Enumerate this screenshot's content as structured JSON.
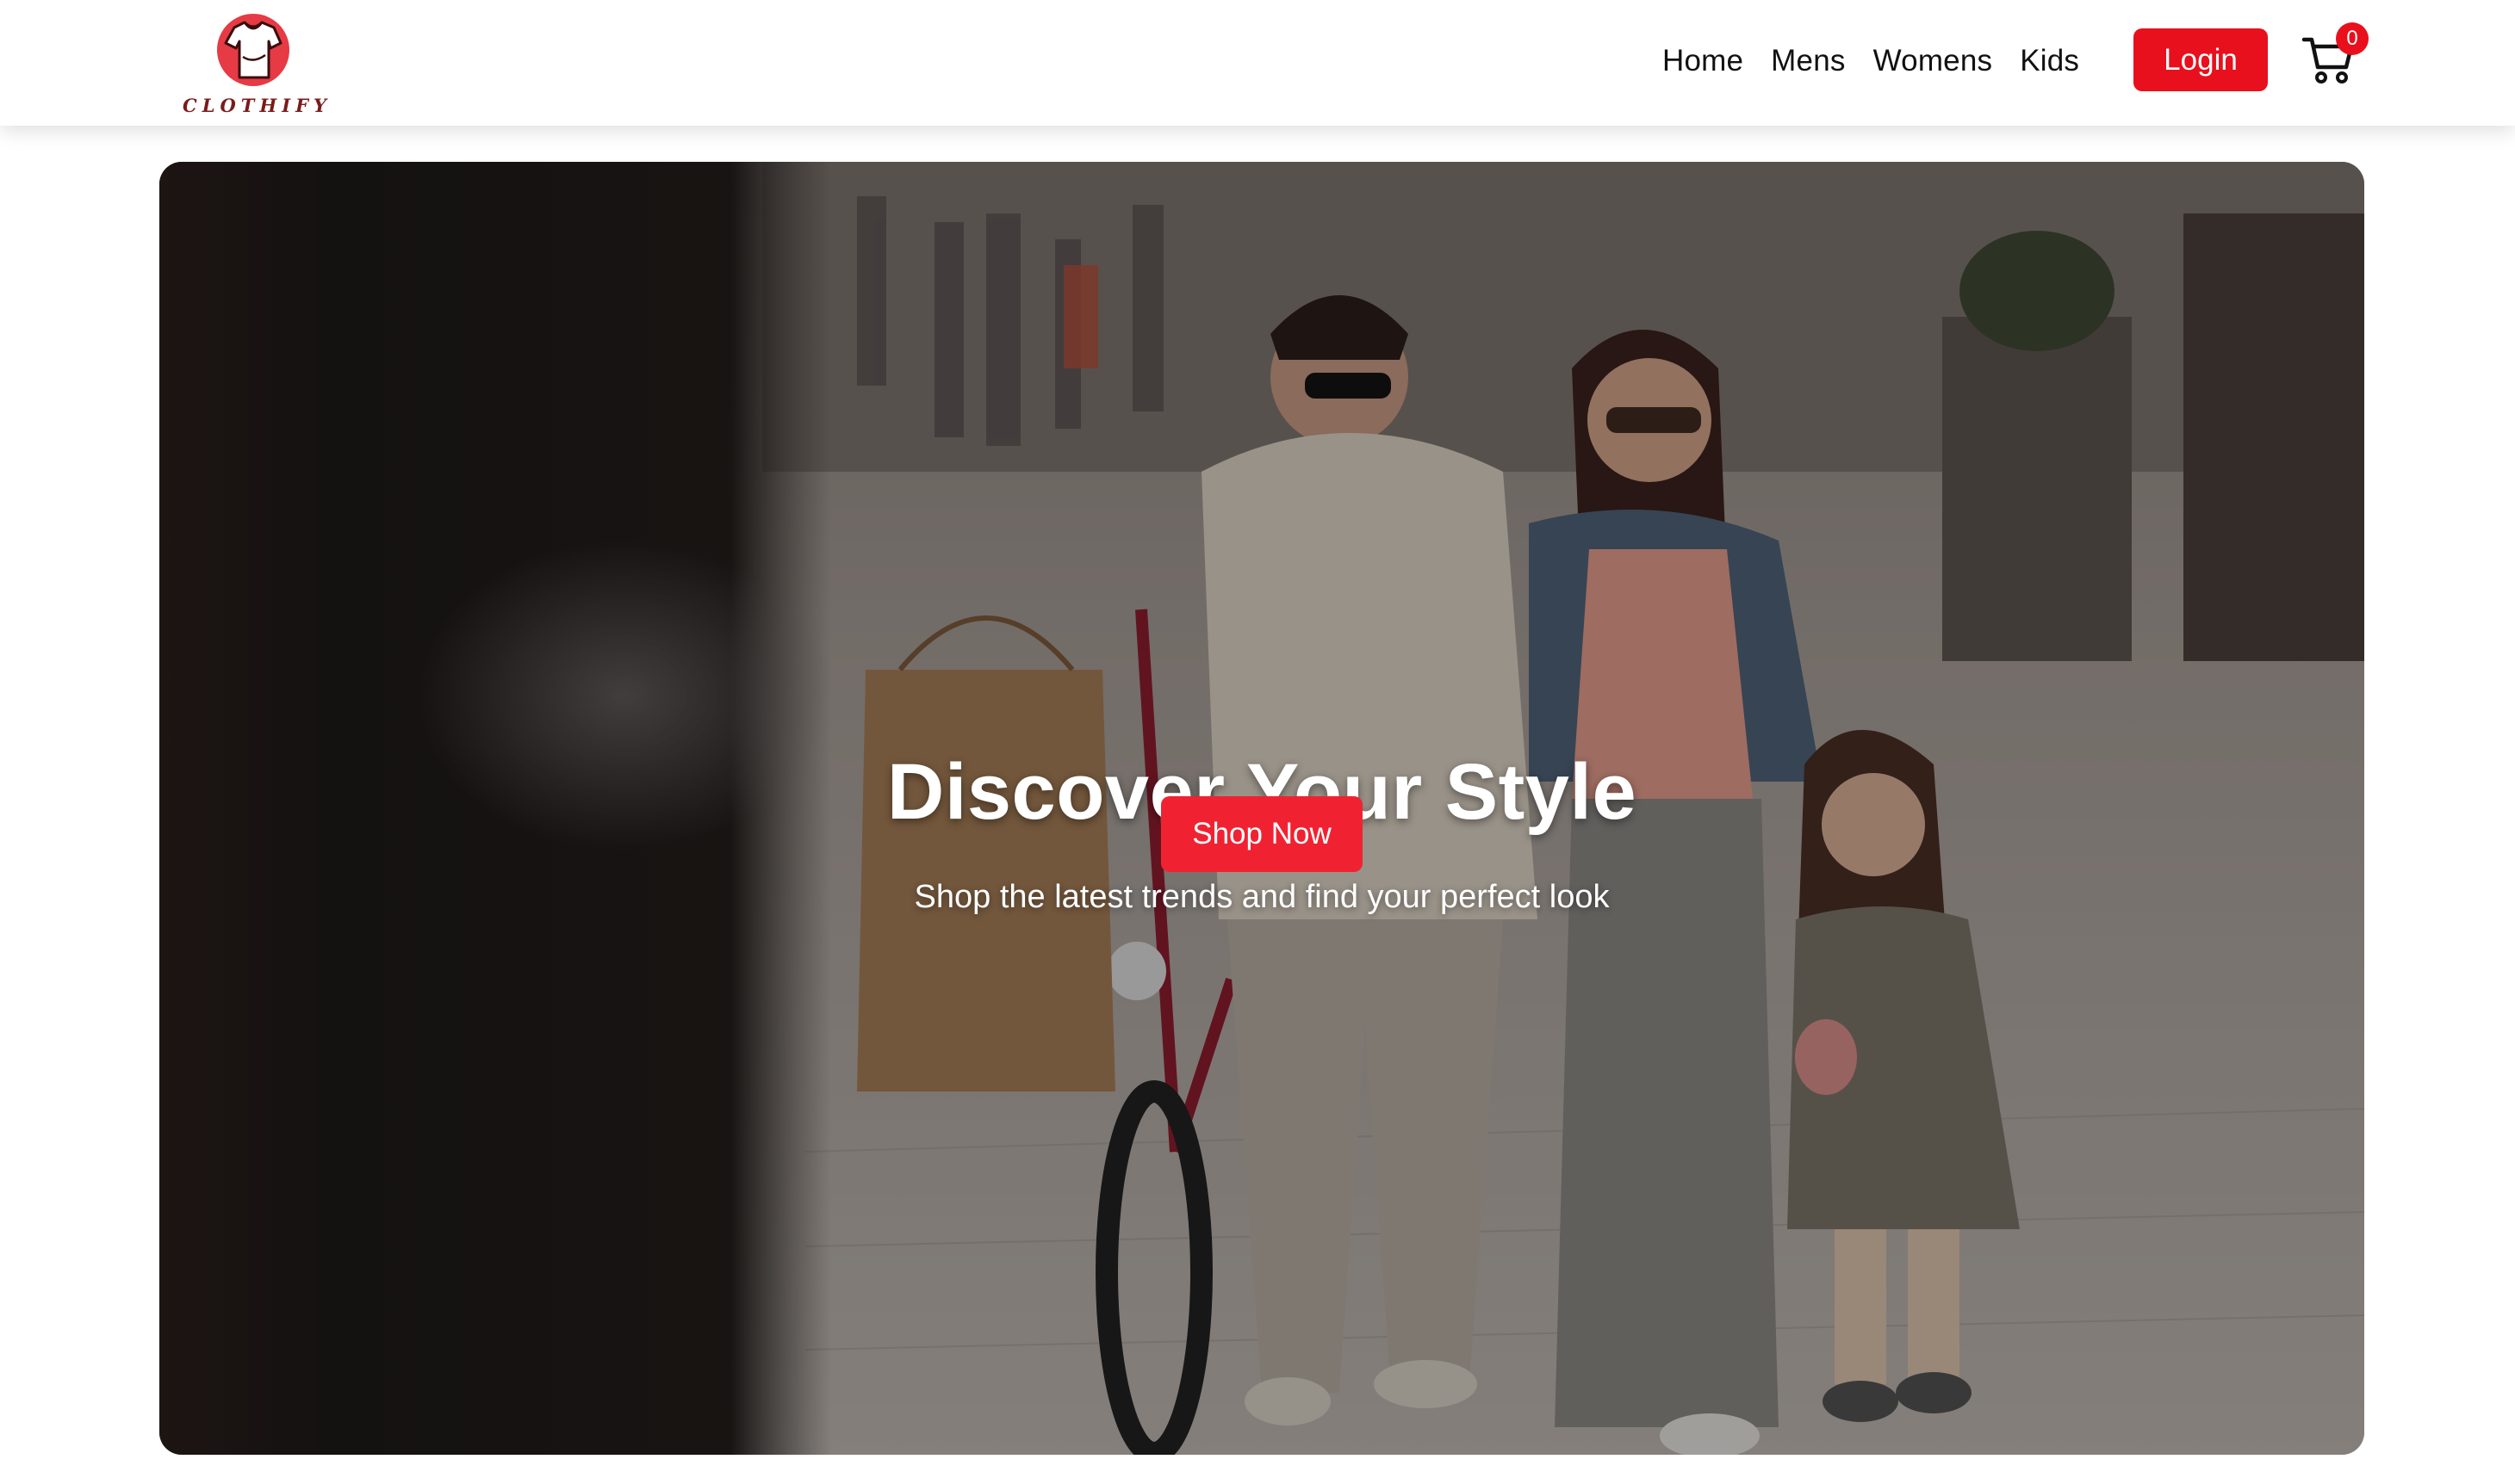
{
  "brand": {
    "name": "CLOTHIFY",
    "icon": "tshirt-logo-icon",
    "accent_color": "#e8101c"
  },
  "nav": {
    "links": [
      "Home",
      "Mens",
      "Womens",
      "Kids"
    ],
    "login_label": "Login",
    "cart_icon": "shopping-cart-icon",
    "cart_count": "0"
  },
  "hero": {
    "title": "Discover Your Style",
    "subtitle": "Shop the latest trends and find your perfect look",
    "cta_label": "Shop Now",
    "cta_color": "#f02232"
  }
}
